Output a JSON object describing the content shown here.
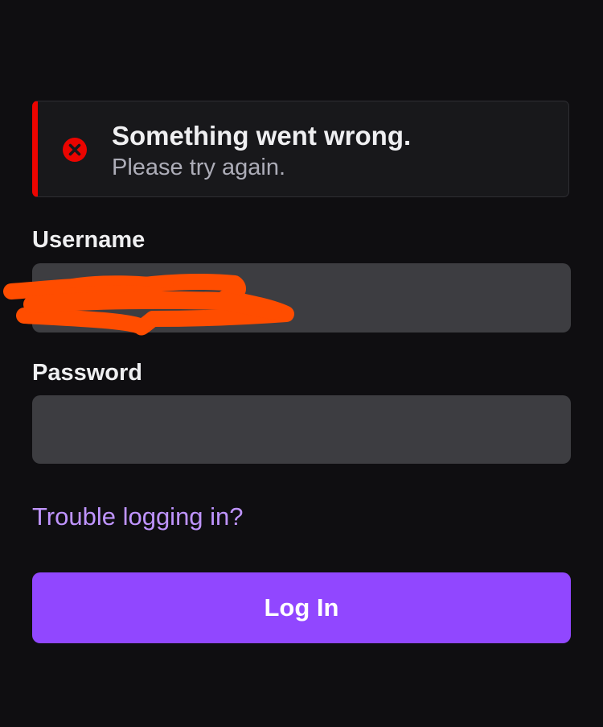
{
  "alert": {
    "title": "Something went wrong.",
    "message": "Please try again.",
    "icon": "error-x-circle-icon",
    "accent_color": "#eb0400"
  },
  "form": {
    "username_label": "Username",
    "username_value": "",
    "password_label": "Password",
    "password_value": ""
  },
  "links": {
    "trouble": "Trouble logging in?"
  },
  "login_button": {
    "label": "Log In"
  },
  "colors": {
    "background": "#0f0e11",
    "input_background": "#3d3d41",
    "link": "#bf94ff",
    "primary": "#9147ff",
    "redaction": "#ff4d00"
  }
}
